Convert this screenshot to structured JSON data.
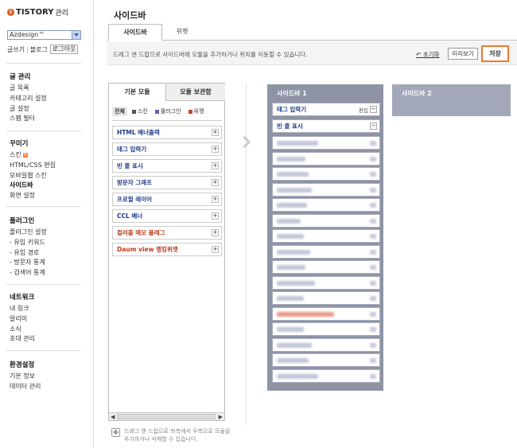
{
  "app": {
    "brand": "TISTORY",
    "brand_sub": "관리",
    "blog_select": "Azdesign™"
  },
  "top_links": {
    "write": "글쓰기",
    "blog": "블로그",
    "logout": "로그아웃"
  },
  "nav": [
    {
      "title": "글 관리",
      "items": [
        {
          "label": "글 목록"
        },
        {
          "label": "카테고리 설정"
        },
        {
          "label": "글 설정"
        },
        {
          "label": "스팸 필터"
        }
      ]
    },
    {
      "title": "꾸미기",
      "items": [
        {
          "label": "스킨"
        },
        {
          "label": "HTML/CSS 편집"
        },
        {
          "label": "모바일웹 스킨"
        },
        {
          "label": "사이드바"
        },
        {
          "label": "화면 설정"
        }
      ]
    },
    {
      "title": "플러그인",
      "items": [
        {
          "label": "플러그인 설정"
        },
        {
          "label": "- 유입 키워드"
        },
        {
          "label": "- 유입 경로"
        },
        {
          "label": "- 방문자 통계"
        },
        {
          "label": "- 검색어 통계"
        }
      ]
    },
    {
      "title": "네트워크",
      "items": [
        {
          "label": "내 링크"
        },
        {
          "label": "알리미"
        },
        {
          "label": "소식"
        },
        {
          "label": "초대 관리"
        }
      ]
    },
    {
      "title": "환경설정",
      "items": [
        {
          "label": "기본 정보"
        },
        {
          "label": "데이터 관리"
        }
      ]
    }
  ],
  "main": {
    "title": "사이드바",
    "tabs": [
      "사이드바",
      "위젯"
    ],
    "description": "드래그 앤 드랍으로 사이드바에 모듈을 추가하거나 위치를 이동할 수 있습니다.",
    "reset": "초기화",
    "preview": "미리보기",
    "save": "저장"
  },
  "module_panel": {
    "tabs": [
      "기본 모듈",
      "모듈 보관함"
    ],
    "filters": [
      {
        "label": "전체"
      },
      {
        "label": "스킨",
        "color": "#555555"
      },
      {
        "label": "플러그인",
        "color": "#5a63b0"
      },
      {
        "label": "위젯",
        "color": "#d0451b"
      }
    ],
    "modules": [
      {
        "label": "HTML 배너출력",
        "red": false
      },
      {
        "label": "태그 입력기",
        "red": false
      },
      {
        "label": "빈 줄 표시",
        "red": false
      },
      {
        "label": "방문자 그래프",
        "red": false
      },
      {
        "label": "프로필 레이어",
        "red": false
      },
      {
        "label": "CCL 배너",
        "red": false
      },
      {
        "label": "컬러풀 메모 플레그",
        "red": true
      },
      {
        "label": "Daum view 랭킹위젯",
        "red": true
      }
    ],
    "scroll_left": "◀",
    "scroll_right": "▶"
  },
  "hint": {
    "icon": "✥",
    "text": "드래그 앤 드랍으로 좌측에서 우측으로 모듈을 추가하거나 삭제할 수 있습니다."
  },
  "sidebar1": {
    "title": "사이드바 1",
    "slots": [
      {
        "label": "태그 입력기",
        "edit": "편집"
      },
      {
        "label": "빈 줄 표시"
      }
    ]
  },
  "sidebar2": {
    "title": "사이드바 2"
  },
  "colors": {
    "accent": "#f07b26",
    "sidebar1_bg": "#8e93a5",
    "sidebar2_bg": "#a2a8b8",
    "module_text": "#1e3a8a",
    "module_red": "#c0391b"
  }
}
